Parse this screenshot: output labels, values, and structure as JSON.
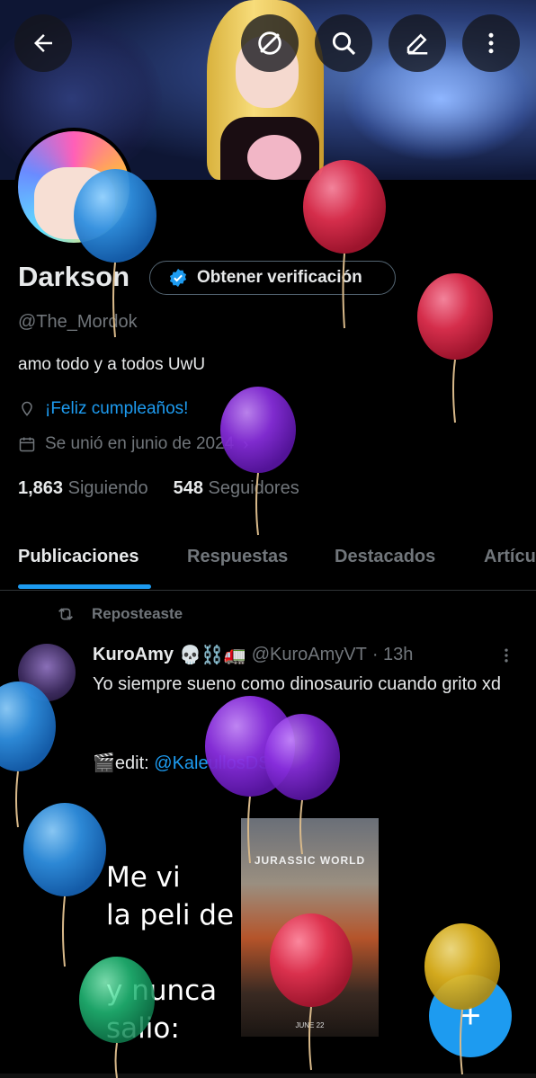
{
  "profile": {
    "name": "Darkson",
    "verify_button": "Obtener verificación",
    "handle": "@The_Mordok",
    "bio": "amo todo y a todos UwU",
    "birthday": "¡Feliz cumpleaños!",
    "joined": "Se unió en junio de 2024",
    "following_count": "1,863",
    "following_label": "Siguiendo",
    "followers_count": "548",
    "followers_label": "Seguidores"
  },
  "tabs": [
    "Publicaciones",
    "Respuestas",
    "Destacados",
    "Artícu"
  ],
  "post": {
    "repost_label": "Reposteaste",
    "author_name": "KuroAmy",
    "author_emoji": "💀⛓️🚛",
    "author_handle": "@KuroAmyVT",
    "time": "· 13h",
    "text": "Yo siempre sueno como dinosaurio cuando grito xd",
    "edit_prefix": "🎬edit:",
    "edit_link": "@KaleullosDS",
    "meme_text": "Me vi\nla peli de\n\ny nunca\nsalio:",
    "poster_title": "JURASSIC WORLD",
    "poster_date": "JUNE 22"
  },
  "icons": {
    "back": "back-arrow-icon",
    "nostr": "link-off-icon",
    "search": "search-icon",
    "edit": "edit-pencil-icon",
    "more": "more-vertical-icon",
    "verified": "verified-badge-icon",
    "location": "location-pin-icon",
    "calendar": "calendar-icon",
    "repost": "repost-icon",
    "compose": "compose-plus-icon"
  },
  "colors": {
    "accent": "#1d9bf0",
    "text": "#e7e9ea",
    "muted": "#71767b",
    "background": "#000000"
  }
}
